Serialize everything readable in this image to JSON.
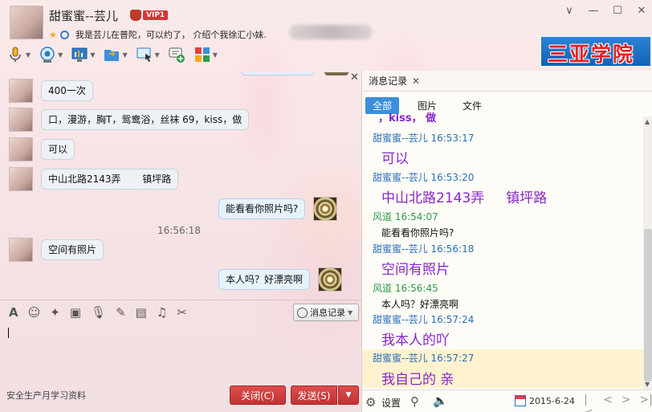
{
  "header": {
    "contact_name": "甜蜜蜜--芸儿",
    "vip_label": "VIP1",
    "signature": "我是芸儿在普陀，可以约了，  介绍个我徐汇小妹.",
    "ad_text": "三亚学院"
  },
  "window_controls": [
    "∨",
    "—",
    "☐",
    "✕"
  ],
  "toolbar": {
    "items": [
      "microphone",
      "video-camera",
      "screen-share",
      "file-transfer",
      "remote-desktop",
      "new-chat",
      "apps"
    ]
  },
  "chat": {
    "messages": [
      {
        "side": "left",
        "text": "400一次"
      },
      {
        "side": "left",
        "text": "口，漫游，胸T，鸳鸯浴，丝袜 69，kiss，做"
      },
      {
        "side": "left",
        "text": "可以"
      },
      {
        "side": "left",
        "text": "中山北路2143弄       镇坪路"
      },
      {
        "side": "right",
        "text": "能看看你照片吗?"
      },
      {
        "side": "left",
        "text": "空间有照片"
      },
      {
        "side": "right",
        "text": "本人吗？好漂亮啊"
      }
    ],
    "time_divider": "16:56:18"
  },
  "input_toolbar": {
    "history_label": "消息记录"
  },
  "footer": {
    "tip": "安全生产月学习资料",
    "close_label": "关闭(C)",
    "send_label": "发送(S)"
  },
  "history_panel": {
    "tab_title": "消息记录",
    "filters": [
      "全部",
      "图片",
      "文件"
    ],
    "entries": [
      {
        "kind": "big",
        "text": "，kiss， 做"
      },
      {
        "kind": "meta",
        "who": "them",
        "text": "甜蜜蜜--芸儿 16:53:17"
      },
      {
        "kind": "big",
        "text": "可以"
      },
      {
        "kind": "meta",
        "who": "them",
        "text": "甜蜜蜜--芸儿 16:53:20"
      },
      {
        "kind": "big",
        "text": "中山北路2143弄     镇坪路"
      },
      {
        "kind": "meta",
        "who": "me",
        "text": "风道 16:54:07"
      },
      {
        "kind": "small",
        "text": "能看看你照片吗?"
      },
      {
        "kind": "meta",
        "who": "them",
        "text": "甜蜜蜜--芸儿 16:56:18"
      },
      {
        "kind": "big",
        "text": "空间有照片"
      },
      {
        "kind": "meta",
        "who": "me",
        "text": "风道 16:56:45"
      },
      {
        "kind": "small",
        "text": "本人吗？好漂亮啊"
      },
      {
        "kind": "meta",
        "who": "them",
        "text": "甜蜜蜜--芸儿 16:57:24"
      },
      {
        "kind": "big",
        "text": "我本人的吖"
      },
      {
        "kind": "meta",
        "who": "them",
        "text": "甜蜜蜜--芸儿 16:57:27"
      },
      {
        "kind": "big",
        "text": "我自己的 亲"
      }
    ],
    "settings_label": "设置",
    "date": "2015-6-24"
  },
  "colors": {
    "accent_blue": "#3b8fdc",
    "send_red": "#c23333",
    "history_purple": "#8a26c9",
    "history_name_blue": "#2c6fbb",
    "history_name_green": "#2f9a47",
    "highlight_yellow": "#fff3cf"
  }
}
